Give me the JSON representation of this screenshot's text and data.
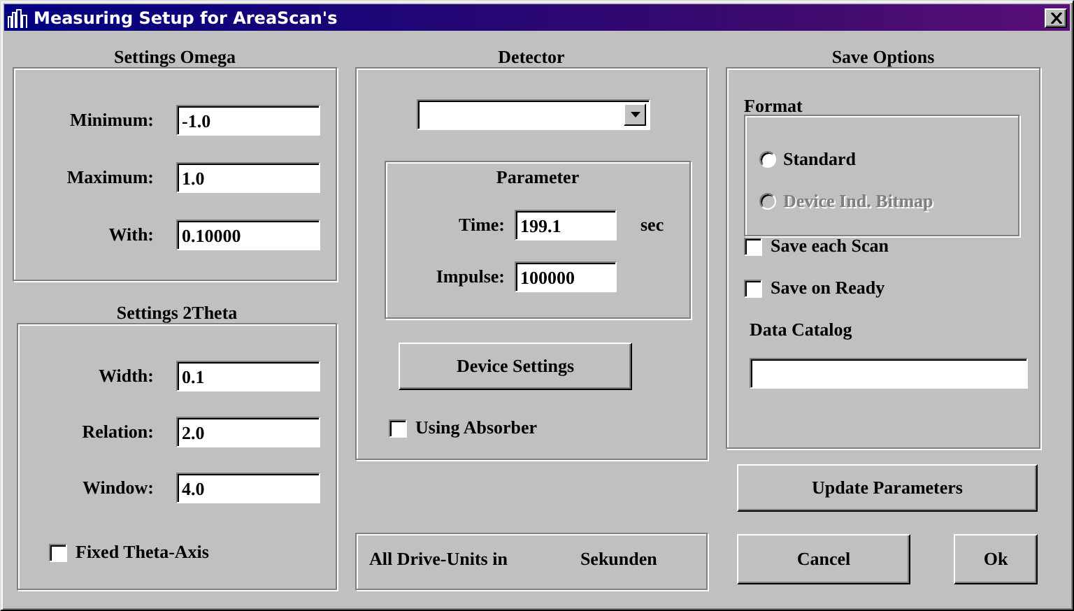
{
  "window": {
    "title": "Measuring Setup for AreaScan's"
  },
  "omega": {
    "heading": "Settings Omega",
    "fields": [
      {
        "label": "Minimum:",
        "value": "-1.0"
      },
      {
        "label": "Maximum:",
        "value": "1.0"
      },
      {
        "label": "With:",
        "value": "0.10000"
      }
    ]
  },
  "two_theta": {
    "heading": "Settings  2Theta",
    "fields": [
      {
        "label": "Width:",
        "value": "0.1"
      },
      {
        "label": "Relation:",
        "value": "2.0"
      },
      {
        "label": "Window:",
        "value": "4.0"
      }
    ],
    "checkbox": {
      "label": "Fixed Theta-Axis",
      "checked": false
    }
  },
  "detector": {
    "heading": "Detector",
    "parameter": {
      "heading": "Parameter",
      "fields": [
        {
          "label": "Time:",
          "value": "199.1",
          "unit": "sec"
        },
        {
          "label": "Impulse:",
          "value": "100000"
        }
      ]
    },
    "device_button": "Device Settings",
    "absorber": {
      "label": "Using Absorber",
      "checked": false
    }
  },
  "drive_units": {
    "label": "All Drive-Units in",
    "value": "Sekunden"
  },
  "save_options": {
    "heading": "Save Options",
    "format": {
      "heading": "Format",
      "options": [
        {
          "label": "Standard",
          "selected": false,
          "disabled": false
        },
        {
          "label": "Device Ind. Bitmap",
          "selected": false,
          "disabled": true
        }
      ]
    },
    "checkboxes": [
      {
        "label": "Save each Scan",
        "checked": false
      },
      {
        "label": "Save on Ready",
        "checked": false
      }
    ],
    "catalog_label": "Data Catalog"
  },
  "buttons": {
    "update": "Update Parameters",
    "cancel": "Cancel",
    "ok": "Ok"
  }
}
